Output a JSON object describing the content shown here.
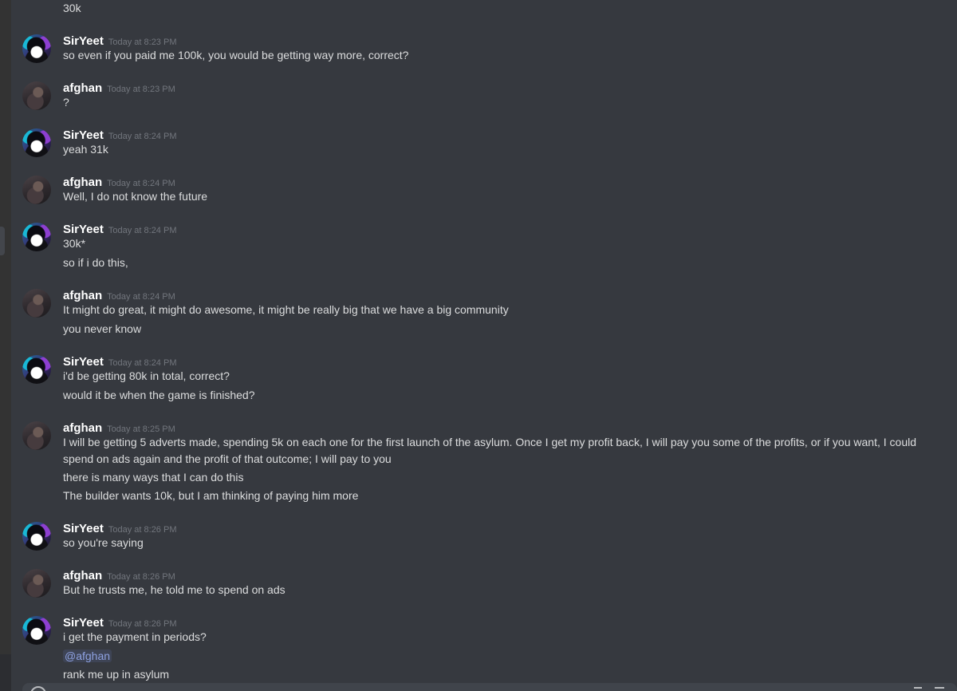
{
  "top_fragment": "30k",
  "messages": [
    {
      "author": "SirYeet",
      "avatar": "sirYeet-avatar",
      "timestamp": "Today at 8:23 PM",
      "lines": [
        "so even if you paid me 100k, you would be getting way more, correct?"
      ]
    },
    {
      "author": "afghan",
      "avatar": "afghan-avatar",
      "timestamp": "Today at 8:23 PM",
      "lines": [
        "?"
      ]
    },
    {
      "author": "SirYeet",
      "avatar": "sirYeet-avatar",
      "timestamp": "Today at 8:24 PM",
      "lines": [
        "yeah 31k"
      ]
    },
    {
      "author": "afghan",
      "avatar": "afghan-avatar",
      "timestamp": "Today at 8:24 PM",
      "lines": [
        "Well, I do not know the future"
      ]
    },
    {
      "author": "SirYeet",
      "avatar": "sirYeet-avatar",
      "timestamp": "Today at 8:24 PM",
      "lines": [
        "30k*",
        "so if i do this,"
      ]
    },
    {
      "author": "afghan",
      "avatar": "afghan-avatar",
      "timestamp": "Today at 8:24 PM",
      "lines": [
        "It might do great, it might do awesome, it might be really big that we have a big community",
        "you never know"
      ]
    },
    {
      "author": "SirYeet",
      "avatar": "sirYeet-avatar",
      "timestamp": "Today at 8:24 PM",
      "lines": [
        "i'd be getting 80k in total, correct?",
        "would it be when the game is finished?"
      ]
    },
    {
      "author": "afghan",
      "avatar": "afghan-avatar",
      "timestamp": "Today at 8:25 PM",
      "lines": [
        "I will be getting 5 adverts made, spending 5k on each one for the first launch of the asylum. Once I get my profit back, I will pay you some of the profits, or if you want, I could spend on ads again and the profit of that outcome; I will pay to you",
        "there is many ways that I can do this",
        "The builder wants 10k, but I am thinking of paying him more"
      ]
    },
    {
      "author": "SirYeet",
      "avatar": "sirYeet-avatar",
      "timestamp": "Today at 8:26 PM",
      "lines": [
        "so you're saying"
      ]
    },
    {
      "author": "afghan",
      "avatar": "afghan-avatar",
      "timestamp": "Today at 8:26 PM",
      "lines": [
        "But he trusts me, he told me to spend on ads"
      ]
    },
    {
      "author": "SirYeet",
      "avatar": "sirYeet-avatar",
      "timestamp": "Today at 8:26 PM",
      "lines": [
        "i get the payment in periods?",
        "@afghan",
        "rank me up in asylum"
      ]
    }
  ]
}
